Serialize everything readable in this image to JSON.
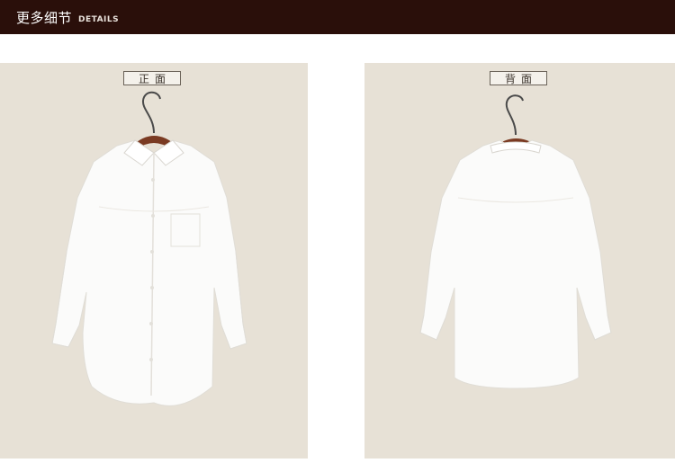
{
  "header": {
    "title_cn": "更多细节",
    "title_en": "DETAILS",
    "background": "#2a0f0a"
  },
  "panels": [
    {
      "id": "front",
      "label": "正面",
      "background": "#e7e1d6"
    },
    {
      "id": "back",
      "label": "背面",
      "background": "#e7e1d6"
    }
  ],
  "colors": {
    "shirt": "#fbfbfa",
    "shirt_shadow": "#d9d6d0",
    "hanger_wood": "#7a3a22",
    "hanger_hook": "#4a4a4a"
  }
}
